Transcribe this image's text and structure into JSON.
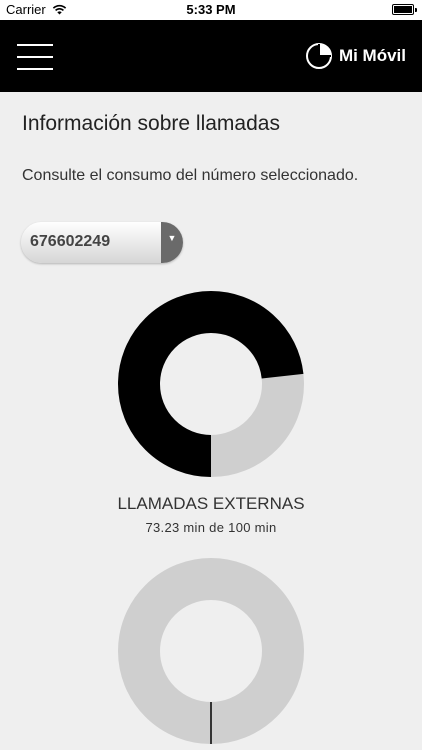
{
  "status_bar": {
    "carrier": "Carrier",
    "time": "5:33 PM"
  },
  "header": {
    "brand": "Mi Móvil"
  },
  "page": {
    "title": "Información sobre llamadas",
    "subtitle": "Consulte el consumo del número seleccionado."
  },
  "number_select": {
    "value": "676602249"
  },
  "colors": {
    "used": "#000000",
    "remaining": "#cfcfcf",
    "background": "#efefef"
  },
  "chart_data": [
    {
      "type": "pie",
      "title": "LLAMADAS EXTERNAS",
      "subtitle": "73.23 min de 100 min",
      "slices": [
        {
          "label": "used",
          "value": 73.23
        },
        {
          "label": "remaining",
          "value": 26.77
        }
      ]
    },
    {
      "type": "pie",
      "slices": [
        {
          "label": "used",
          "value": 0
        },
        {
          "label": "remaining",
          "value": 100
        }
      ]
    }
  ]
}
